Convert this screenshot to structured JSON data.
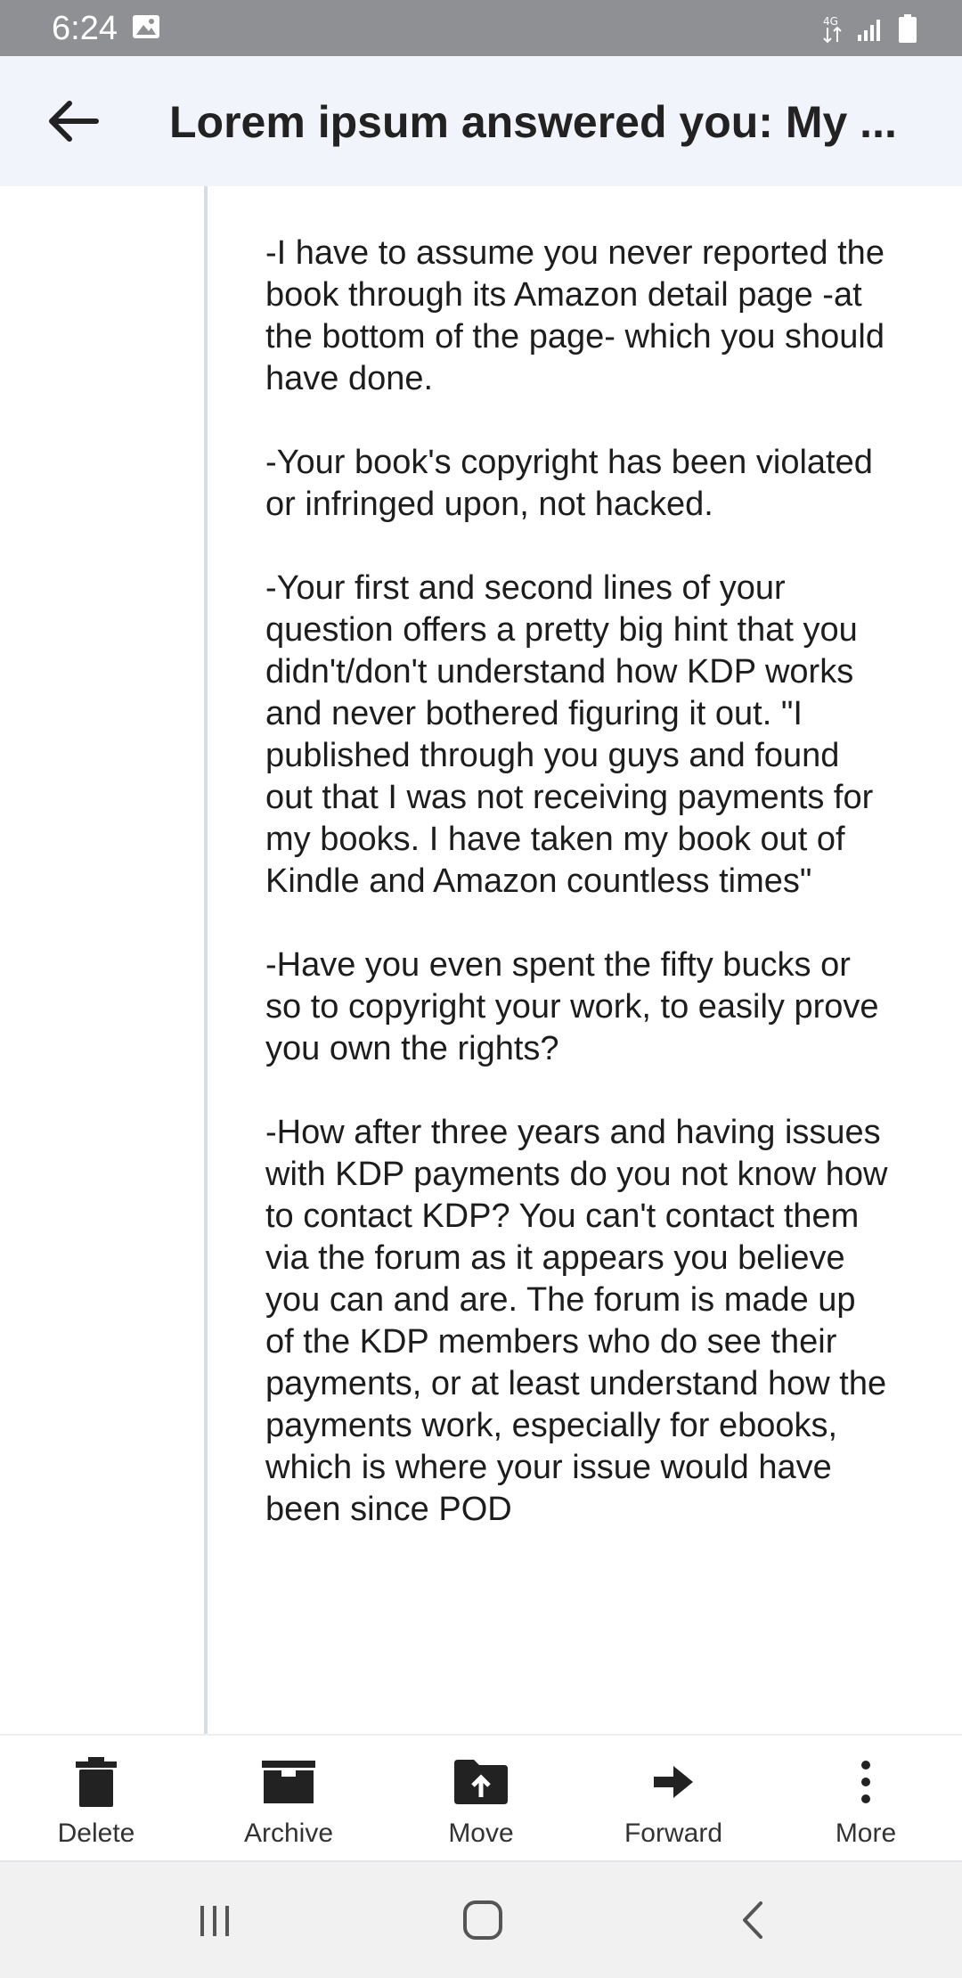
{
  "status_bar": {
    "time": "6:24",
    "icons": [
      "gallery-icon",
      "data-arrows-icon",
      "signal-icon",
      "battery-icon"
    ]
  },
  "header": {
    "title": "Lorem ipsum answered you: My ...",
    "back_icon": "back-arrow-icon"
  },
  "message": {
    "paragraphs": [
      "-I have to assume you never reported the book through its Amazon detail page -at the bottom of the page- which you should have done.",
      "-Your book's copyright has been violated or infringed upon, not hacked.",
      "-Your first and second lines of your question offers a pretty big hint that you didn't/don't understand how KDP works and never bothered figuring it out. \"I published through you guys and found out that I was not receiving payments for my books. I have taken my book out of Kindle and Amazon countless times\"",
      "-Have you even spent the fifty bucks or so to copyright your work, to easily prove you own the rights?",
      "-How after three years and having issues with KDP payments do you not know how to contact KDP? You can't contact them via the forum as it appears you believe you can and are. The forum is made up of the KDP members who do see their payments, or at least understand how the payments work, especially for ebooks, which is where your issue would have been since POD"
    ]
  },
  "toolbar": {
    "delete_label": "Delete",
    "archive_label": "Archive",
    "move_label": "Move",
    "forward_label": "Forward",
    "more_label": "More"
  },
  "nav": {
    "icons": [
      "recents-icon",
      "home-icon",
      "back-icon"
    ]
  },
  "colors": {
    "status_bar": "#8f9093",
    "app_bar": "#f2f4fc",
    "quote_bar": "#d7dde6",
    "nav_bar": "#f1f1f1"
  }
}
